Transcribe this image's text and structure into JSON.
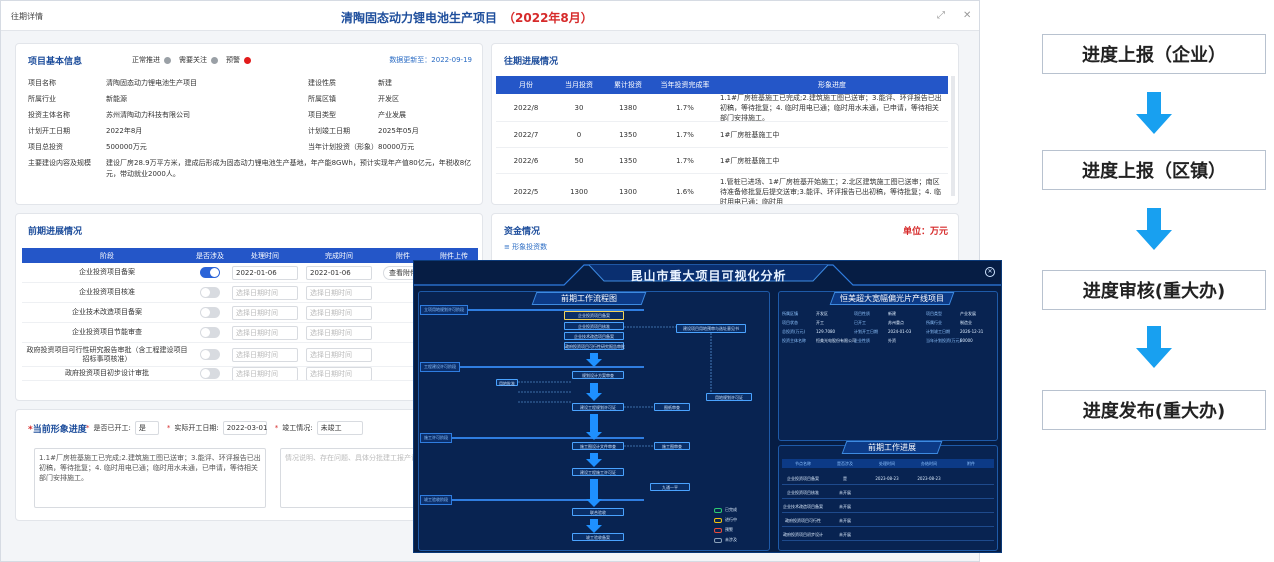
{
  "window": {
    "label": "往期详情",
    "title": "清陶固态动力锂电池生产项目",
    "period": "（2022年8月）"
  },
  "basic": {
    "title": "项目基本信息",
    "legend": [
      "正常推进",
      "需要关注",
      "预警"
    ],
    "legend_colors": [
      "#9aa0a6",
      "#9aa0a6",
      "#e21b1b"
    ],
    "date": "数据更新至：2022-09-19",
    "left": [
      {
        "k": "项目名称",
        "v": "清陶固态动力锂电池生产项目"
      },
      {
        "k": "所属行业",
        "v": "新能源"
      },
      {
        "k": "投资主体名称",
        "v": "苏州清陶动力科技有限公司"
      },
      {
        "k": "计划开工日期",
        "v": "2022年8月"
      },
      {
        "k": "项目总投资",
        "v": "500000万元"
      }
    ],
    "right": [
      {
        "k": "建设性质",
        "v": "新建"
      },
      {
        "k": "所属区镇",
        "v": "开发区"
      },
      {
        "k": "项目类型",
        "v": "产业发展"
      },
      {
        "k": "计划竣工日期",
        "v": "2025年05月"
      },
      {
        "k": "当年计划投资（形象）",
        "v": "80000万元"
      }
    ],
    "scale_label": "主要建设内容及规模",
    "scale_text": "建设厂房28.9万平方米，建成后形成为固态动力锂电池生产基地，年产能8GWh，预计实现年产值80亿元，年税收8亿元，带动就业2000人。"
  },
  "past": {
    "title": "往期进展情况",
    "headers": [
      "月份",
      "当月投资",
      "累计投资",
      "当年投资完成率",
      "形象进度"
    ],
    "rows": [
      [
        "2022/8",
        "30",
        "1380",
        "1.7%",
        "1.1#厂房桩基施工已完成;2.建筑施工图已送审；3.能评、环评报告已出初稿，等待批复；4. 临时用电已通；临时用水未通，已申请，等待相关部门安排施工。"
      ],
      [
        "2022/7",
        "0",
        "1350",
        "1.7%",
        "1#厂房桩基施工中"
      ],
      [
        "2022/6",
        "50",
        "1350",
        "1.7%",
        "1#厂房桩基施工中"
      ],
      [
        "2022/5",
        "1300",
        "1300",
        "1.6%",
        "1.管桩已进场、1#厂房桩基开始施工；2.北区建筑施工图已送审；南区待准备修批复后提交送审;3.能评、环评报告已出初稿，等待批复；4. 临时用电已通；临时用"
      ]
    ]
  },
  "prework": {
    "title": "前期进展情况",
    "headers": [
      "阶段",
      "是否涉及",
      "处理时间",
      "完成时间",
      "附件",
      "附件上传"
    ],
    "placeholder": "选择日期时间",
    "view_btn": "查看附件",
    "rows": [
      {
        "name": "企业投资项目备案",
        "on": true,
        "start": "2022-01-06",
        "end": "2022-01-06"
      },
      {
        "name": "企业投资项目核准",
        "on": false
      },
      {
        "name": "企业技术改造项目备案",
        "on": false
      },
      {
        "name": "企业投资项目节能审查",
        "on": false
      },
      {
        "name": "政府投资项目可行性研究报告审批（含工程建设项目招标事项核准）",
        "on": false
      },
      {
        "name": "政府投资项目初步设计审批",
        "on": false
      }
    ]
  },
  "funds": {
    "title": "资金情况",
    "unit": "单位：万元",
    "sub": "≡ 形象投资数"
  },
  "current": {
    "title": "当前形象进度",
    "started_label": "是否已开工:",
    "started_value": "是",
    "actual_label": "实际开工日期:",
    "actual_value": "2022-03-01",
    "completed_label": "竣工情况:",
    "completed_value": "未竣工",
    "text": "1.1#厂房桩基施工已完成;2.建筑施工图已送审；3.能评、环评报告已出初稿，等待批复；4. 临时用电已通；临时用水未通，已申请，等待相关部门安排施工。",
    "placeholder": "情况说明、存在问题、具体分批建工报产说明等"
  },
  "dashboard": {
    "title": "昆山市重大项目可视化分析",
    "flow_title": "前期工作流程图",
    "project_title": "恒美超大宽幅偏光片产线项目",
    "progress_title": "前期工作进展",
    "sections": [
      "立项用地规划许可阶段",
      "工程建设许可阶段",
      "施工许可阶段",
      "竣工验收阶段"
    ],
    "flow_boxes": [
      "企业投资项目备案",
      "企业投资项目核准",
      "企业技术改造项目备案",
      "政府投资项目可行性研究报告审批",
      "建设项目用地预审与选址意见书",
      "规划设计方案审查",
      "建设工程规划许可证",
      "图纸审查",
      "施工图设计文件审查",
      "建设工程施工许可证",
      "联合验收",
      "竣工验收备案",
      "用地规划许可证",
      "用地批准",
      "施工图审查",
      "九通一平"
    ],
    "info": [
      {
        "k": "所属区镇",
        "v": "开发区"
      },
      {
        "k": "项目性质",
        "v": "新建"
      },
      {
        "k": "项目类型",
        "v": "产业发展"
      },
      {
        "k": "项目状态",
        "v": "开工"
      },
      {
        "k": "已开工",
        "v": "苏州重点"
      },
      {
        "k": "所属行业",
        "v": "制造业"
      },
      {
        "k": "总投资(万元)",
        "v": "129.7080"
      },
      {
        "k": "计划开工日期",
        "v": "2024-01-03"
      },
      {
        "k": "计划竣工日期",
        "v": "2026-12-31"
      },
      {
        "k": "投资主体名称",
        "v": "恒美光电股份有限公司"
      },
      {
        "k": "企业性质",
        "v": "外资"
      },
      {
        "k": "当年计划投资(万元)",
        "v": "80000"
      }
    ],
    "progress_headers": [
      "节点名称",
      "是否涉及",
      "处理时间",
      "办结时间",
      "附件"
    ],
    "progress_rows": [
      [
        "企业投资项目备案",
        "是",
        "2023-08-23",
        "2023-08-23",
        ""
      ],
      [
        "企业投资项目核准",
        "未开展",
        "",
        "",
        ""
      ],
      [
        "企业技术改造项目备案",
        "未开展",
        "",
        "",
        ""
      ],
      [
        "政府投资项目可行性",
        "未开展",
        "",
        "",
        ""
      ],
      [
        "政府投资项目初步设计",
        "未开展",
        "",
        "",
        ""
      ]
    ],
    "legend": [
      "已完成",
      "进行中",
      "预警",
      "未涉及"
    ]
  },
  "steps": [
    "进度上报（企业）",
    "进度上报（区镇）",
    "进度审核(重大办)",
    "进度发布(重大办)"
  ]
}
